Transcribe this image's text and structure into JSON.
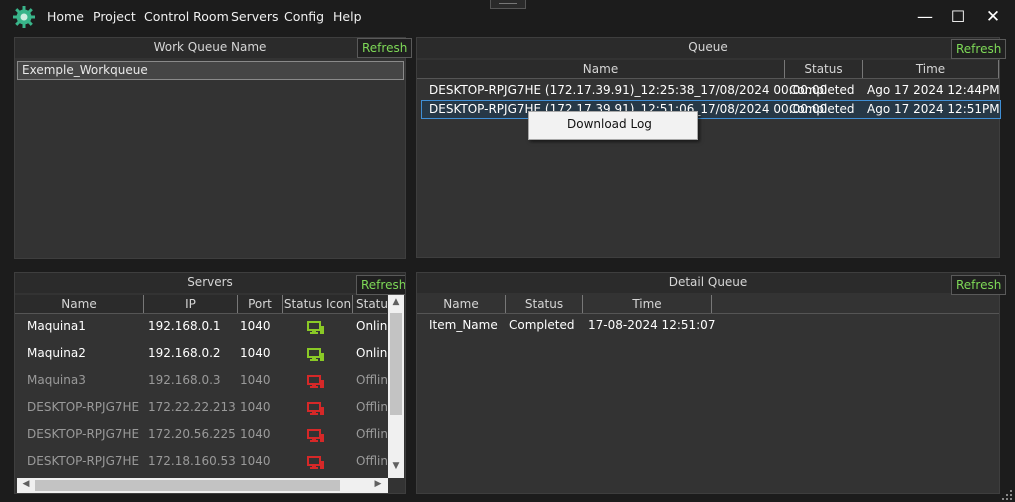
{
  "menu": [
    "Home",
    "Project",
    "Control Room",
    "Servers",
    "Config",
    "Help"
  ],
  "window_controls": {
    "minimize": "—",
    "maximize": "☐",
    "close": "✕"
  },
  "work_queue": {
    "title": "Work Queue Name",
    "refresh": "Refresh",
    "items": [
      "Exemple_Workqueue"
    ]
  },
  "queue": {
    "title": "Queue",
    "refresh": "Refresh",
    "columns": [
      "Name",
      "Status",
      "Time"
    ],
    "rows": [
      {
        "name": "DESKTOP-RPJG7HE (172.17.39.91)_12:25:38_17/08/2024 00:00:00",
        "status": "Completed",
        "time": "Ago 17 2024 12:44PM"
      },
      {
        "name": "DESKTOP-RPJG7HE (172.17.39.91)_12:51:06_17/08/2024 00:00:00",
        "status": "Completed",
        "time": "Ago 17 2024 12:51PM"
      }
    ],
    "context_menu": [
      "Download Log"
    ]
  },
  "servers": {
    "title": "Servers",
    "refresh": "Refresh",
    "columns": [
      "Name",
      "IP",
      "Port",
      "Status Icon",
      "Status"
    ],
    "rows": [
      {
        "name": "Maquina1",
        "ip": "192.168.0.1",
        "port": "1040",
        "icon": "monitor-online-icon",
        "status": "Online"
      },
      {
        "name": "Maquina2",
        "ip": "192.168.0.2",
        "port": "1040",
        "icon": "monitor-online-icon",
        "status": "Online"
      },
      {
        "name": "Maquina3",
        "ip": "192.168.0.3",
        "port": "1040",
        "icon": "monitor-offline-icon",
        "status": "Offline"
      },
      {
        "name": "DESKTOP-RPJG7HE",
        "ip": "172.22.22.213",
        "port": "1040",
        "icon": "monitor-offline-icon",
        "status": "Offline"
      },
      {
        "name": "DESKTOP-RPJG7HE",
        "ip": "172.20.56.225",
        "port": "1040",
        "icon": "monitor-offline-icon",
        "status": "Offline"
      },
      {
        "name": "DESKTOP-RPJG7HE",
        "ip": "172.18.160.53",
        "port": "1040",
        "icon": "monitor-offline-icon",
        "status": "Offline"
      }
    ]
  },
  "detail_queue": {
    "title": "Detail Queue",
    "refresh": "Refresh",
    "columns": [
      "Name",
      "Status",
      "Time"
    ],
    "rows": [
      {
        "name": "Item_Name",
        "status": "Completed",
        "time": "17-08-2024 12:51:07"
      }
    ]
  },
  "colors": {
    "accent": "#7ed957",
    "online": "#8ac926",
    "offline": "#d62828",
    "selection": "#3f8fd6"
  }
}
